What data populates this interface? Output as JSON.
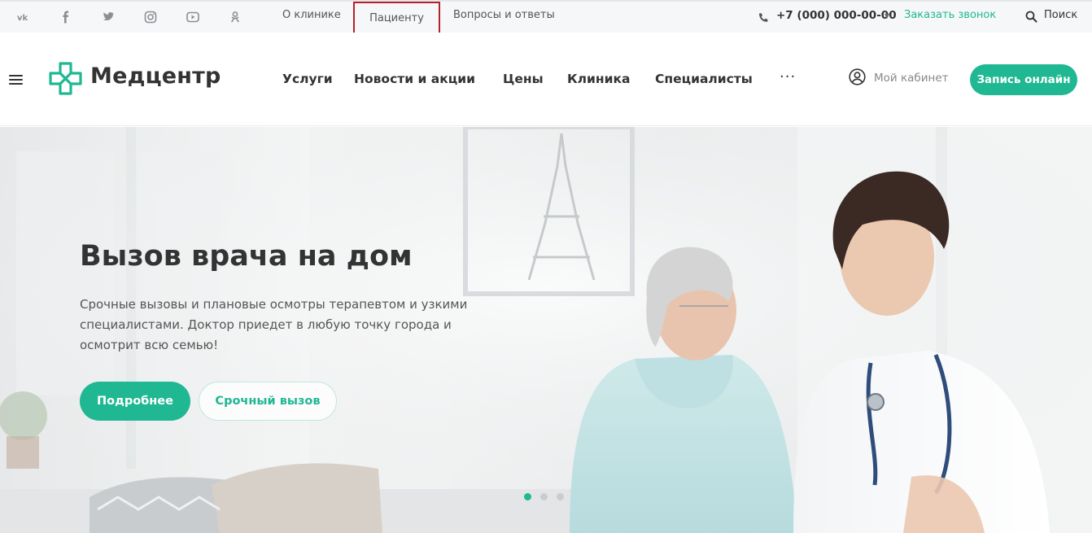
{
  "topbar": {
    "social": [
      {
        "name": "vk-icon",
        "glyph": "vk"
      },
      {
        "name": "facebook-icon",
        "glyph": "f"
      },
      {
        "name": "twitter-icon",
        "glyph": "twitter"
      },
      {
        "name": "instagram-icon",
        "glyph": "instagram"
      },
      {
        "name": "youtube-icon",
        "glyph": "youtube"
      },
      {
        "name": "odnoklassniki-icon",
        "glyph": "ok"
      }
    ],
    "links": {
      "about": "О клинике",
      "patient": "Пациенту",
      "faq": "Вопросы и ответы"
    },
    "phone": "+7 (000) 000-00-00",
    "callback": "Заказать звонок",
    "search": "Поиск"
  },
  "header": {
    "logo": "Медцентр",
    "nav": {
      "services": "Услуги",
      "news": "Новости и акции",
      "prices": "Цены",
      "clinic": "Клиника",
      "specialists": "Специалисты",
      "more": "···"
    },
    "cabinet": "Мой кабинет",
    "book": "Запись онлайн"
  },
  "hero": {
    "title": "Вызов врача на дом",
    "text": "Срочные вызовы и плановые осмотры терапевтом и узкими специалистами. Доктор приедет в любую точку города и осмотрит всю семью!",
    "more": "Подробнее",
    "urgent": "Срочный вызов",
    "slides": {
      "count": 3,
      "active": 1
    }
  },
  "colors": {
    "accent": "#1fb892",
    "highlight": "#b4222c",
    "text": "#333333"
  }
}
